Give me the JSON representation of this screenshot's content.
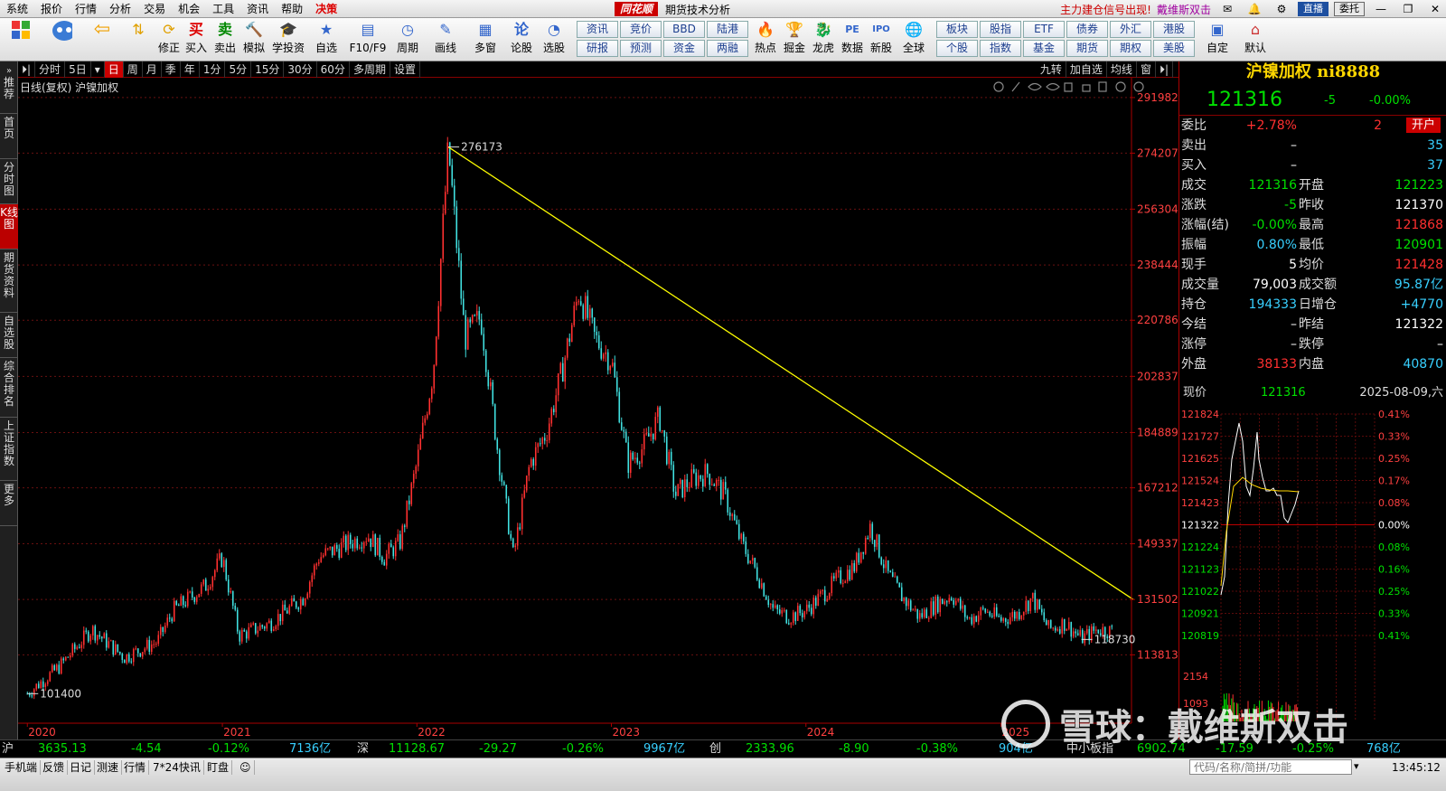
{
  "menu": {
    "items": [
      "系统",
      "报价",
      "行情",
      "分析",
      "交易",
      "机会",
      "工具",
      "资讯",
      "帮助",
      "决策"
    ],
    "logo": "同花顺",
    "subtitle": "期货技术分析",
    "ad1": "主力建仓信号出现!",
    "ad2": "戴维斯双击",
    "live_btn": "直播",
    "entrust_btn": "委托"
  },
  "toolbar": {
    "tools": [
      {
        "icon": "grid-icon",
        "label": ""
      },
      {
        "icon": "robot-icon",
        "label": ""
      },
      {
        "icon": "back-arrow-icon",
        "label": ""
      },
      {
        "icon": "up-down-arrow-icon",
        "label": "修正"
      },
      {
        "icon": "buy-icon",
        "label": "买入"
      },
      {
        "icon": "sell-icon",
        "label": "卖出"
      },
      {
        "icon": "hammer-icon",
        "label": "模拟"
      },
      {
        "icon": "graduation-cap-icon",
        "label": "学投资"
      },
      {
        "icon": "star-icon",
        "label": "自选"
      },
      {
        "icon": "f10-icon",
        "label": "F10/F9"
      },
      {
        "icon": "clock-icon",
        "label": "周期"
      },
      {
        "icon": "pen-icon",
        "label": "画线"
      },
      {
        "icon": "multi-window-icon",
        "label": "多窗"
      },
      {
        "icon": "discuss-icon",
        "label": "论股"
      },
      {
        "icon": "select-stock-icon",
        "label": "选股"
      }
    ],
    "btn_grid": [
      [
        "资讯",
        "竞价",
        "BBD",
        "陆港"
      ],
      [
        "研报",
        "预测",
        "资金",
        "两融"
      ]
    ],
    "tools2": [
      {
        "icon": "hot-icon",
        "label": "热点"
      },
      {
        "icon": "cup-icon",
        "label": "掘金"
      },
      {
        "icon": "dragon-icon",
        "label": "龙虎"
      },
      {
        "icon": "pe-icon",
        "label": "数据"
      },
      {
        "icon": "ipo-icon",
        "label": "新股"
      },
      {
        "icon": "globe-icon",
        "label": "全球"
      }
    ],
    "btn_grid2": [
      [
        "板块",
        "股指",
        "ETF",
        "债券",
        "外汇",
        "港股"
      ],
      [
        "个股",
        "指数",
        "基金",
        "期货",
        "期权",
        "美股"
      ]
    ],
    "tools3": [
      {
        "icon": "custom-icon",
        "label": "自定"
      },
      {
        "icon": "home-icon",
        "label": "默认"
      }
    ]
  },
  "leftnav": [
    "推荐",
    "首页",
    "分时图",
    "K线图",
    "期货资料",
    "自选股",
    "综合排名",
    "上证指数",
    "更多"
  ],
  "periods": [
    "分时",
    "5日",
    "日",
    "周",
    "月",
    "季",
    "年",
    "1分",
    "5分",
    "15分",
    "30分",
    "60分",
    "多周期",
    "设置"
  ],
  "period_active": "日",
  "periods_right": [
    "九转",
    "加自选",
    "均线",
    "窗"
  ],
  "chart_head": "日线(复权)  沪镍加权",
  "chart_data": {
    "type": "candlestick",
    "title": "沪镍加权 日线(复权)",
    "x_ticks": [
      "2020",
      "2021",
      "2022",
      "2023",
      "2024",
      "2025"
    ],
    "y_ticks": [
      291982,
      274207,
      256304,
      238444,
      220786,
      202837,
      184889,
      167212,
      149337,
      131502,
      113813
    ],
    "ylim": [
      96000,
      296000
    ],
    "annotations": {
      "high": 276173,
      "low_start": 101400,
      "recent_low": 118730
    },
    "trendline": {
      "from": {
        "date": "2022-03",
        "value": 276173
      },
      "to": {
        "date": "2025-08",
        "value": 131502
      },
      "color": "#ffff00"
    },
    "series": [
      {
        "t": "2020-01",
        "v": 101400
      },
      {
        "t": "2020-03",
        "v": 110000
      },
      {
        "t": "2020-05",
        "v": 122000
      },
      {
        "t": "2020-07",
        "v": 113000
      },
      {
        "t": "2020-09",
        "v": 118000
      },
      {
        "t": "2020-10",
        "v": 128000
      },
      {
        "t": "2020-12",
        "v": 136000
      },
      {
        "t": "2021-01",
        "v": 145000
      },
      {
        "t": "2021-02",
        "v": 120000
      },
      {
        "t": "2021-04",
        "v": 124000
      },
      {
        "t": "2021-06",
        "v": 132000
      },
      {
        "t": "2021-07",
        "v": 145000
      },
      {
        "t": "2021-09",
        "v": 150000
      },
      {
        "t": "2021-10",
        "v": 152000
      },
      {
        "t": "2021-11",
        "v": 145000
      },
      {
        "t": "2021-12",
        "v": 150000
      },
      {
        "t": "2022-01",
        "v": 175000
      },
      {
        "t": "2022-02",
        "v": 205000
      },
      {
        "t": "2022-03",
        "v": 276173
      },
      {
        "t": "2022-04",
        "v": 215000
      },
      {
        "t": "2022-05",
        "v": 222000
      },
      {
        "t": "2022-06",
        "v": 180000
      },
      {
        "t": "2022-07",
        "v": 145000
      },
      {
        "t": "2022-08",
        "v": 175000
      },
      {
        "t": "2022-09",
        "v": 185000
      },
      {
        "t": "2022-10",
        "v": 205000
      },
      {
        "t": "2022-11",
        "v": 230000
      },
      {
        "t": "2022-12",
        "v": 215000
      },
      {
        "t": "2023-01",
        "v": 208000
      },
      {
        "t": "2023-02",
        "v": 175000
      },
      {
        "t": "2023-03",
        "v": 180000
      },
      {
        "t": "2023-04",
        "v": 190000
      },
      {
        "t": "2023-05",
        "v": 165000
      },
      {
        "t": "2023-06",
        "v": 170000
      },
      {
        "t": "2023-07",
        "v": 172000
      },
      {
        "t": "2023-08",
        "v": 165000
      },
      {
        "t": "2023-09",
        "v": 150000
      },
      {
        "t": "2023-10",
        "v": 140000
      },
      {
        "t": "2023-11",
        "v": 128000
      },
      {
        "t": "2023-12",
        "v": 126000
      },
      {
        "t": "2024-01",
        "v": 128000
      },
      {
        "t": "2024-02",
        "v": 133000
      },
      {
        "t": "2024-03",
        "v": 138000
      },
      {
        "t": "2024-04",
        "v": 142000
      },
      {
        "t": "2024-05",
        "v": 155000
      },
      {
        "t": "2024-06",
        "v": 140000
      },
      {
        "t": "2024-07",
        "v": 132000
      },
      {
        "t": "2024-08",
        "v": 126000
      },
      {
        "t": "2024-09",
        "v": 130000
      },
      {
        "t": "2024-10",
        "v": 133000
      },
      {
        "t": "2024-11",
        "v": 125000
      },
      {
        "t": "2024-12",
        "v": 128000
      },
      {
        "t": "2025-01",
        "v": 125000
      },
      {
        "t": "2025-02",
        "v": 127000
      },
      {
        "t": "2025-03",
        "v": 132000
      },
      {
        "t": "2025-04",
        "v": 122000
      },
      {
        "t": "2025-05",
        "v": 124000
      },
      {
        "t": "2025-06",
        "v": 119000
      },
      {
        "t": "2025-07",
        "v": 122000
      },
      {
        "t": "2025-08",
        "v": 121316
      }
    ]
  },
  "quote": {
    "name": "沪镍加权",
    "code": "ni8888",
    "price": "121316",
    "change": "-5",
    "pct": "-0.00%",
    "open_btn": "开户",
    "rows": [
      {
        "l": "委比",
        "v": "+2.78%",
        "vc": "red",
        "l2": "",
        "v2": "2",
        "v2c": "red"
      },
      {
        "l": "卖出",
        "v": "–",
        "vc": "white",
        "l2": "",
        "v2": "35",
        "v2c": "cyan"
      },
      {
        "l": "买入",
        "v": "–",
        "vc": "white",
        "l2": "",
        "v2": "37",
        "v2c": "cyan"
      },
      {
        "l": "成交",
        "v": "121316",
        "vc": "green",
        "l2": "开盘",
        "v2": "121223",
        "v2c": "green"
      },
      {
        "l": "涨跌",
        "v": "-5",
        "vc": "green",
        "l2": "昨收",
        "v2": "121370",
        "v2c": "white"
      },
      {
        "l": "涨幅(结)",
        "v": "-0.00%",
        "vc": "green",
        "l2": "最高",
        "v2": "121868",
        "v2c": "red"
      },
      {
        "l": "振幅",
        "v": "0.80%",
        "vc": "cyan",
        "l2": "最低",
        "v2": "120901",
        "v2c": "green"
      },
      {
        "l": "现手",
        "v": "5",
        "vc": "white",
        "l2": "均价",
        "v2": "121428",
        "v2c": "red"
      },
      {
        "l": "成交量",
        "v": "79,003",
        "vc": "white",
        "l2": "成交额",
        "v2": "95.87亿",
        "v2c": "cyan"
      },
      {
        "l": "持仓",
        "v": "194333",
        "vc": "cyan",
        "l2": "日增仓",
        "v2": "+4770",
        "v2c": "cyan"
      },
      {
        "l": "今结",
        "v": "–",
        "vc": "white",
        "l2": "昨结",
        "v2": "121322",
        "v2c": "white"
      },
      {
        "l": "涨停",
        "v": "–",
        "vc": "white",
        "l2": "跌停",
        "v2": "–",
        "v2c": "white"
      },
      {
        "l": "外盘",
        "v": "38133",
        "vc": "red",
        "l2": "内盘",
        "v2": "40870",
        "v2c": "cyan"
      }
    ],
    "intraday": {
      "label": "现价",
      "price": "121316",
      "date": "2025-08-09,六",
      "left_ticks": [
        "121824",
        "121727",
        "121625",
        "121524",
        "121423",
        "121322",
        "121224",
        "121123",
        "121022",
        "120921",
        "120819"
      ],
      "right_ticks": [
        "0.41%",
        "0.33%",
        "0.25%",
        "0.17%",
        "0.08%",
        "0.00%",
        "0.08%",
        "0.16%",
        "0.25%",
        "0.33%",
        "0.41%"
      ],
      "vol_ticks": [
        "2154",
        "1093"
      ]
    }
  },
  "status": {
    "sh_label": "沪",
    "sh_val": "3635.13",
    "sh_chg": "-4.54",
    "sh_pct": "-0.12%",
    "sh_amt": "7136亿",
    "sz_label": "深",
    "sz_val": "11128.67",
    "sz_chg": "-29.27",
    "sz_pct": "-0.26%",
    "sz_amt": "9967亿",
    "cy_label": "创",
    "cy_val": "2333.96",
    "cy_chg": "-8.90",
    "cy_pct": "-0.38%",
    "cy_amt": "904亿",
    "zx_label": "中小板指",
    "zx_val": "6902.74",
    "zx_chg": "-17.59",
    "zx_pct": "-0.25%",
    "zx_amt": "768亿"
  },
  "bottom": {
    "items": [
      "手机端",
      "反馈",
      "日记",
      "测速",
      "行情",
      "7*24快讯",
      "盯盘"
    ],
    "search_placeholder": "代码/名称/简拼/功能",
    "clock": "13:45:12"
  },
  "watermark": "雪球：戴维斯双击"
}
